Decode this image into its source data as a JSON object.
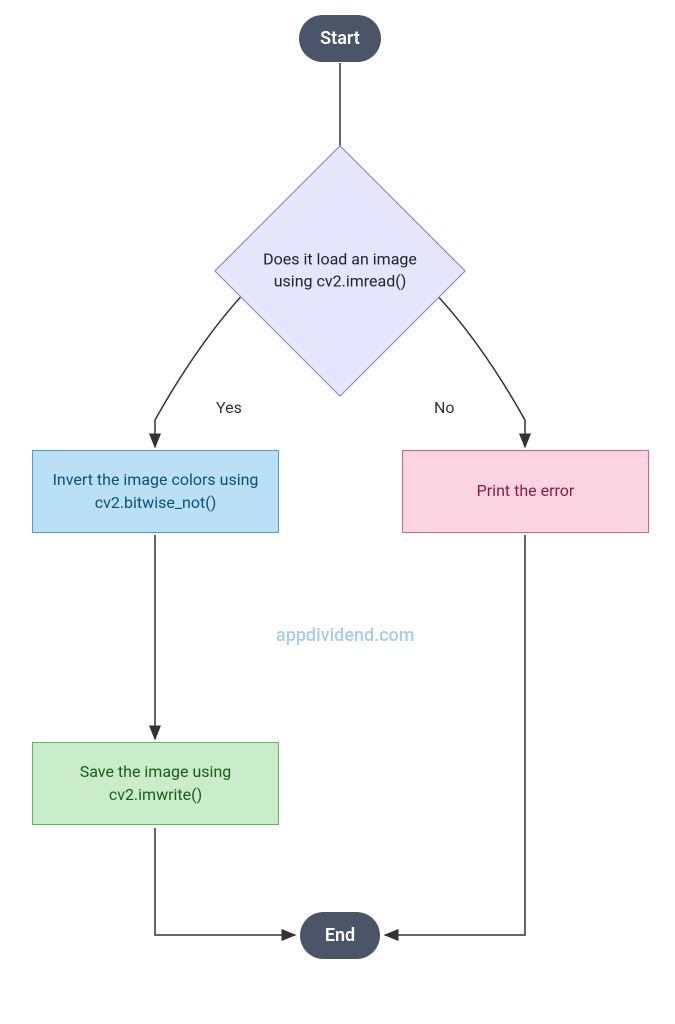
{
  "nodes": {
    "start": {
      "label": "Start"
    },
    "decision": {
      "label": "Does it load an image using cv2.imread()"
    },
    "invert": {
      "label": "Invert the image colors using cv2.bitwise_not()"
    },
    "error": {
      "label": "Print the error"
    },
    "save": {
      "label": "Save the image using cv2.imwrite()"
    },
    "end": {
      "label": "End"
    }
  },
  "edges": {
    "yes": "Yes",
    "no": "No"
  },
  "watermark": "appdividend.com"
}
